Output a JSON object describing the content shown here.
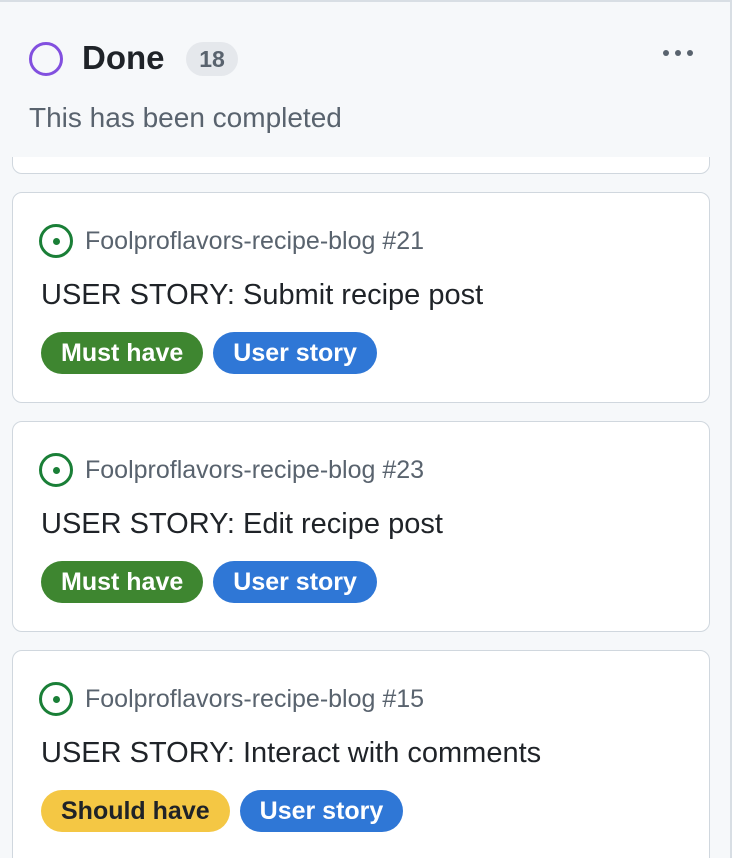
{
  "column": {
    "title": "Done",
    "count": "18",
    "description": "This has been completed",
    "status_color": "#8250df"
  },
  "cards": [
    {
      "repo": "Foolproflavors-recipe-blog #21",
      "title": "USER STORY: Submit recipe post",
      "labels": [
        {
          "text": "Must have",
          "bg": "#3e8630",
          "fg": "#ffffff"
        },
        {
          "text": "User story",
          "bg": "#2f77d6",
          "fg": "#ffffff"
        }
      ]
    },
    {
      "repo": "Foolproflavors-recipe-blog #23",
      "title": "USER STORY: Edit recipe post",
      "labels": [
        {
          "text": "Must have",
          "bg": "#3e8630",
          "fg": "#ffffff"
        },
        {
          "text": "User story",
          "bg": "#2f77d6",
          "fg": "#ffffff"
        }
      ]
    },
    {
      "repo": "Foolproflavors-recipe-blog #15",
      "title": "USER STORY: Interact with comments",
      "labels": [
        {
          "text": "Should have",
          "bg": "#f4c744",
          "fg": "#1f2328"
        },
        {
          "text": "User story",
          "bg": "#2f77d6",
          "fg": "#ffffff"
        }
      ]
    }
  ],
  "icons": {
    "status": "circle-icon",
    "issue": "issue-opened-icon",
    "menu": "kebab-horizontal-icon"
  }
}
